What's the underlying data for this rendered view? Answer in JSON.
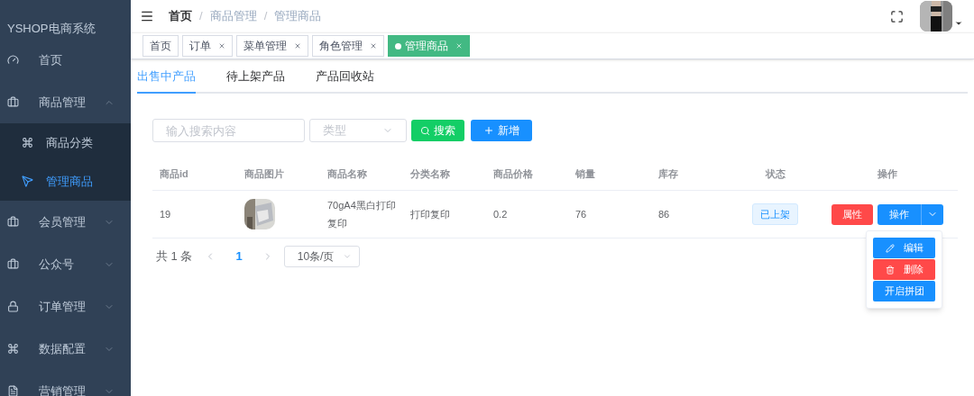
{
  "app_title": "YSHOP电商系统",
  "sidebar": {
    "items": [
      {
        "label": "首页",
        "selected": false
      },
      {
        "label": "商品管理",
        "selected": false,
        "expanded": true,
        "children": [
          {
            "label": "商品分类",
            "selected": false
          },
          {
            "label": "管理商品",
            "selected": true
          }
        ]
      },
      {
        "label": "会员管理",
        "selected": false,
        "expanded": false
      },
      {
        "label": "公众号",
        "selected": false,
        "expanded": false
      },
      {
        "label": "订单管理",
        "selected": false,
        "expanded": false
      },
      {
        "label": "数据配置",
        "selected": false,
        "expanded": false
      },
      {
        "label": "营销管理",
        "selected": false,
        "expanded": false
      }
    ]
  },
  "breadcrumb": [
    {
      "kind": "link",
      "label": "首页"
    },
    {
      "kind": "separator",
      "label": "/"
    },
    {
      "kind": "text",
      "label": "商品管理"
    },
    {
      "kind": "separator",
      "label": "/"
    },
    {
      "kind": "text",
      "label": "管理商品"
    }
  ],
  "tags": [
    {
      "label": "首页",
      "selected": false,
      "closable": false
    },
    {
      "label": "订单",
      "selected": false,
      "closable": true
    },
    {
      "label": "菜单管理",
      "selected": false,
      "closable": true
    },
    {
      "label": "角色管理",
      "selected": false,
      "closable": true
    },
    {
      "label": "管理商品",
      "selected": true,
      "closable": true
    }
  ],
  "tabs": [
    {
      "label": "出售中产品",
      "selected": true
    },
    {
      "label": "待上架产品",
      "selected": false
    },
    {
      "label": "产品回收站",
      "selected": false
    }
  ],
  "search": {
    "placeholder": "输入搜索内容"
  },
  "type_select": {
    "placeholder": "类型"
  },
  "buttons": {
    "search": "搜索",
    "add": "新增"
  },
  "table": {
    "columns": [
      "商品id",
      "商品图片",
      "商品名称",
      "分类名称",
      "商品价格",
      "销量",
      "库存",
      "状态",
      "操作"
    ],
    "rows": [
      {
        "id": "19",
        "name": "70gA4黑白打印复印",
        "category": "打印复印",
        "price": "0.2",
        "sales": "76",
        "stock": "86",
        "status": "已上架",
        "actions": {
          "attr": "属性",
          "ops": "操作"
        }
      }
    ]
  },
  "action_menu": [
    {
      "label": "编辑",
      "kind": "edit"
    },
    {
      "label": "删除",
      "kind": "delete"
    },
    {
      "label": "开启拼团",
      "kind": "plain"
    }
  ],
  "pagination": {
    "total": "共 1 条",
    "pages": [
      {
        "label": "1",
        "selected": true
      }
    ],
    "page_size": "10条/页"
  }
}
